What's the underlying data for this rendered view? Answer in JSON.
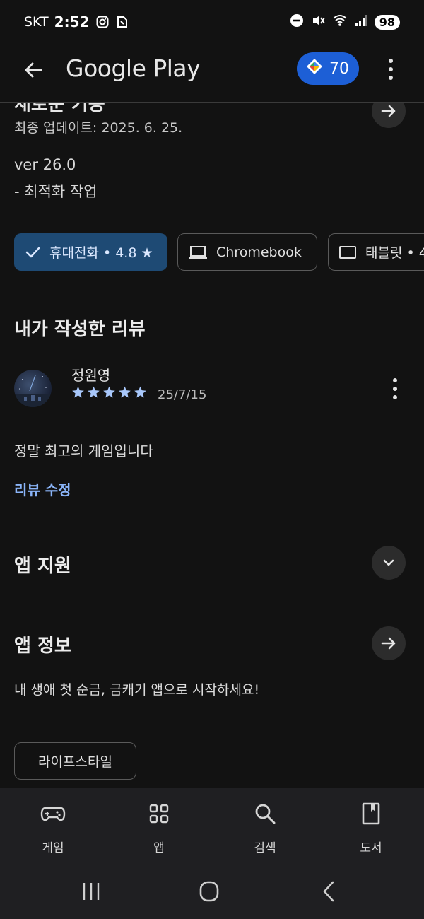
{
  "status_bar": {
    "carrier": "SKT",
    "time": "2:52",
    "battery": "98"
  },
  "app_bar": {
    "title": "Google Play",
    "points": "70"
  },
  "whats_new": {
    "title": "새로운 기능",
    "updated": "최종 업데이트: 2025. 6. 25.",
    "version": "ver 26.0",
    "notes": "- 최적화 작업"
  },
  "device_chips": [
    {
      "label": "휴대전화 • 4.8 ★",
      "selected": true
    },
    {
      "label": "Chromebook",
      "selected": false
    },
    {
      "label": "태블릿 • 4",
      "selected": false
    }
  ],
  "my_review": {
    "section_title": "내가 작성한 리뷰",
    "reviewer": "정원영",
    "rating": 5,
    "date": "25/7/15",
    "text": "정말 최고의 게임입니다",
    "edit_label": "리뷰 수정"
  },
  "app_support": {
    "title": "앱 지원"
  },
  "app_info": {
    "title": "앱 정보",
    "description": "내 생애 첫 순금, 금캐기 앱으로 시작하세요!",
    "tag": "라이프스타일"
  },
  "bottom_nav": [
    {
      "label": "게임",
      "icon": "gamepad-icon"
    },
    {
      "label": "앱",
      "icon": "apps-grid-icon"
    },
    {
      "label": "검색",
      "icon": "search-icon"
    },
    {
      "label": "도서",
      "icon": "book-icon"
    }
  ],
  "colors": {
    "background": "#121212",
    "accent_blue": "#1d5fd6",
    "selected_chip": "#1e4a74",
    "star": "#a8c7fa",
    "link": "#8ab4f8"
  }
}
